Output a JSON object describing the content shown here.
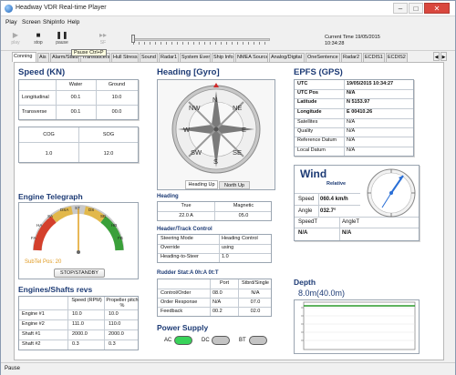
{
  "window": {
    "title": "Headway VDR Real-time Player",
    "min": "–",
    "max": "□",
    "close": "✕"
  },
  "menu": [
    "Play",
    "Screen",
    "ShipInfo",
    "Help"
  ],
  "toolbar": {
    "play": "play",
    "stop": "stop",
    "pause": "pause",
    "sf": "SF",
    "tooltip": "Pause Ctrl+P",
    "current_time_label": "Current Time",
    "current_date": "19/05/2015",
    "current_time": "10:34:28"
  },
  "tabs": [
    "Conning",
    "Ais",
    "Alarm/Status",
    "Transducers",
    "Hull Stress",
    "Sound",
    "Radar1",
    "System Event",
    "Ship Info",
    "NMEA Source",
    "Analog/Digital",
    "OneSentence",
    "Radar2",
    "ECDIS1",
    "ECDIS2"
  ],
  "speed": {
    "title": "Speed (KN)",
    "water_label": "Water",
    "ground_label": "Ground",
    "rows": [
      {
        "label": "Longitudinal",
        "water": "00.1",
        "ground": "10.0"
      },
      {
        "label": "Transverse",
        "water": "00.1",
        "ground": "00.0"
      }
    ],
    "cog_label": "COG",
    "sog_label": "SOG",
    "cog": "1.0",
    "sog": "12.0"
  },
  "heading_gyro": {
    "title": "Heading [Gyro]",
    "points": [
      "N",
      "NE",
      "E",
      "SE",
      "S",
      "SW",
      "W",
      "NW"
    ],
    "tab_heading_up": "Heading Up",
    "tab_north_up": "North Up"
  },
  "heading": {
    "title": "Heading",
    "true_label": "True",
    "magnetic_label": "Magnetic",
    "true": "22.0 A",
    "magnetic": "05.0"
  },
  "header_control": {
    "title": "Header/Track Control",
    "rows": [
      {
        "label": "Steering Mode",
        "value": "Heading Control"
      },
      {
        "label": "Override",
        "value": "using"
      },
      {
        "label": "Heading-to-Steer",
        "value": "1.0"
      }
    ]
  },
  "rudder": {
    "title": "Rudder Stat:A 0h:A 0t:T",
    "port_label": "Port",
    "stbd_label": "Stbrd/Single",
    "rows": [
      {
        "label": "Control/Order",
        "port": "08.0",
        "stbd": "N/A"
      },
      {
        "label": "Order Response",
        "port": "N/A",
        "stbd": "07.0"
      },
      {
        "label": "Feedback",
        "port": "00.2",
        "stbd": "02.0"
      }
    ]
  },
  "power": {
    "title": "Power Supply",
    "ac": "AC",
    "dc": "DC",
    "bt": "BT"
  },
  "engine_telegraph": {
    "title": "Engine Telegraph",
    "scale": [
      "FA",
      "HA",
      "SA",
      "DSA",
      "ST",
      "DS",
      "SB",
      "HB",
      "FB"
    ],
    "sub_tel_pos": "SubTel Pos: 20",
    "button": "STOP/STANDBY"
  },
  "engines": {
    "title": "Engines/Shafts revs",
    "speed_label": "Speed (RPM)",
    "pitch_label": "Propeller pitch %",
    "rows": [
      {
        "label": "Engine #1",
        "speed": "10.0",
        "pitch": "10.0"
      },
      {
        "label": "Engine #2",
        "speed": "111.0",
        "pitch": "110.0"
      },
      {
        "label": "Shaft #1",
        "speed": "2000.0",
        "pitch": "2000.0"
      },
      {
        "label": "Shaft #2",
        "speed": "0.3",
        "pitch": "0.3"
      }
    ]
  },
  "epfs": {
    "title": "EPFS (GPS)",
    "rows": [
      {
        "label": "UTC",
        "value": "19/05/2015 10:34:27",
        "bold": true
      },
      {
        "label": "UTC Pos",
        "value": "N/A",
        "bold": true
      },
      {
        "label": "Latitude",
        "value": "N 5153.97",
        "bold": true
      },
      {
        "label": "Longitude",
        "value": "E 00410.26",
        "bold": true
      },
      {
        "label": "Satellites",
        "value": "N/A",
        "bold": false
      },
      {
        "label": "Quality",
        "value": "N/A",
        "bold": false
      },
      {
        "label": "Reference Datum",
        "value": "N/A",
        "bold": false
      },
      {
        "label": "Local Datum",
        "value": "N/A",
        "bold": false
      }
    ]
  },
  "wind": {
    "title": "Wind",
    "relative": "Relative",
    "speed_label": "Speed",
    "speed": "060.4 km/h",
    "angle_label": "Angle",
    "angle": "032.7°",
    "speed_t_label": "SpeedT",
    "angle_t_label": "AngleT",
    "speed_t": "N/A",
    "angle_t": "N/A"
  },
  "depth": {
    "title": "Depth",
    "value": "8.0m(40.0m)"
  },
  "status": "Pause",
  "colors": {
    "heading_text": "#1d3b75",
    "ac_led": "#39d35a",
    "off_led": "#c4c4c4"
  }
}
